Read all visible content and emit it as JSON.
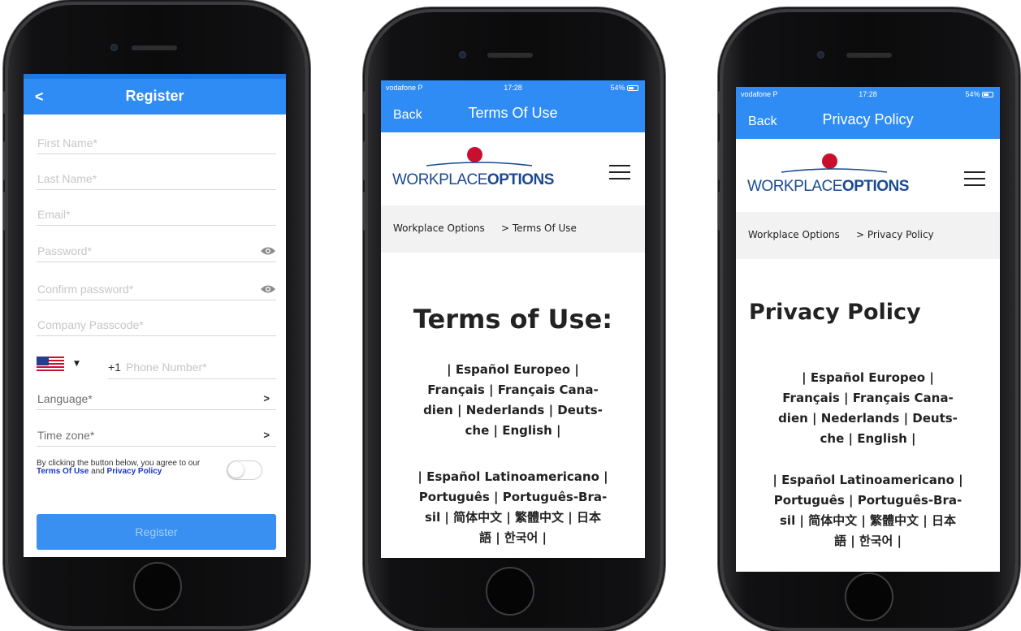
{
  "register": {
    "back_icon": "chevron-left-icon",
    "back_glyph": "<",
    "title": "Register",
    "fields": [
      {
        "placeholder": "First Name*"
      },
      {
        "placeholder": "Last Name*"
      },
      {
        "placeholder": "Email*"
      },
      {
        "placeholder": "Password*",
        "icon": "eye-icon"
      },
      {
        "placeholder": "Confirm password*",
        "icon": "eye-icon"
      },
      {
        "placeholder": "Company Passcode*"
      }
    ],
    "phone": {
      "country_flag": "us-flag-icon",
      "caret": "▼",
      "code": "+1",
      "placeholder": "Phone Number*"
    },
    "language": {
      "label": "Language*",
      "arrow": ">"
    },
    "timezone": {
      "label": "Time zone*",
      "arrow": ">"
    },
    "agree": {
      "text_before": "By clicking the button below, you agree to our ",
      "terms_link": "Terms Of Use",
      "and": " and ",
      "privacy_link": "Privacy Policy"
    },
    "agree_toggle_on": false,
    "submit_label": "Register"
  },
  "terms_view": {
    "status": {
      "carrier": "vodafone P",
      "time": "17:28",
      "battery": "54%"
    },
    "nav": {
      "back": "Back",
      "title": "Terms Of Use"
    },
    "logo": {
      "prefix": "WORKPLACE",
      "suffix": "OPTIONS"
    },
    "breadcrumb": {
      "home": "Workplace Options",
      "current": "> Terms Of Use"
    },
    "heading": "Terms of Use:",
    "lang_lines_1": [
      "| Español Europeo |",
      "Français | Français Cana-",
      "dien | Nederlands | Deuts-",
      "che | English |"
    ],
    "lang_lines_2": [
      "| Español Latinoamericano |",
      "Português | Português-Bra-",
      "sil | 简体中文 | 繁體中文 | 日本",
      "語 | 한국어 |"
    ]
  },
  "privacy_view": {
    "status": {
      "carrier": "vodafone P",
      "time": "17:28",
      "battery": "54%"
    },
    "nav": {
      "back": "Back",
      "title": "Privacy Policy"
    },
    "logo": {
      "prefix": "WORKPLACE",
      "suffix": "OPTIONS"
    },
    "breadcrumb": {
      "home": "Workplace Options",
      "current": "> Privacy Policy"
    },
    "heading": "Privacy Policy",
    "lang_lines_1": [
      "| Español Europeo |",
      "Français | Français Cana-",
      "dien | Nederlands | Deuts-",
      "che | English |"
    ],
    "lang_lines_2": [
      "| Español Latinoamericano |",
      "Português | Português-Bra-",
      "sil | 简体中文 | 繁體中文 | 日本",
      "語 | 한국어 |"
    ]
  },
  "colors": {
    "nav_blue": "#2f8cf4",
    "link_blue": "#1838c8",
    "logo_red": "#c8102e",
    "logo_navy": "#1a4a92"
  }
}
